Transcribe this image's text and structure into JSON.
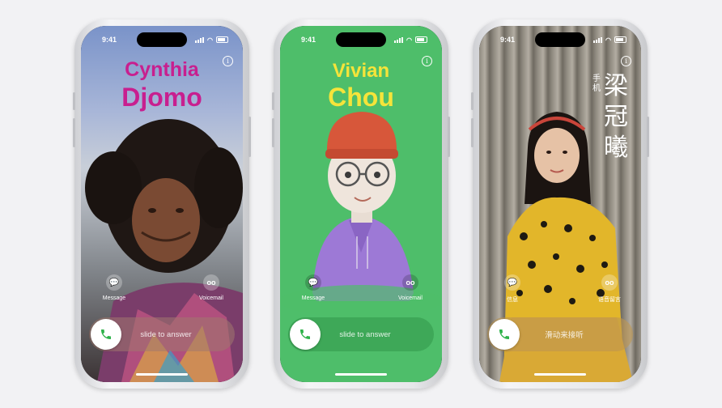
{
  "phones": [
    {
      "time": "9:41",
      "name_first": "Cynthia",
      "name_last": "Djomo",
      "name_color": "#c81f8f",
      "actions": [
        {
          "label": "Message",
          "icon": "message-icon"
        },
        {
          "label": "Voicemail",
          "icon": "voicemail-icon"
        }
      ],
      "slide_text": "slide to answer"
    },
    {
      "time": "9:41",
      "name_first": "Vivian",
      "name_last": "Chou",
      "name_color": "#f5e43a",
      "background": "#4ebe6a",
      "actions": [
        {
          "label": "Message",
          "icon": "message-icon"
        },
        {
          "label": "Voicemail",
          "icon": "voicemail-icon"
        }
      ],
      "slide_text": "slide to answer"
    },
    {
      "time": "9:41",
      "label_small": "手机",
      "name_cjk": "梁冠曦",
      "actions": [
        {
          "label": "信息",
          "icon": "message-icon"
        },
        {
          "label": "语音留言",
          "icon": "voicemail-icon"
        }
      ],
      "slide_text": "滑动来接听"
    }
  ],
  "colors": {
    "answer_green": "#2fb24a",
    "page_bg": "#f2f2f4"
  }
}
